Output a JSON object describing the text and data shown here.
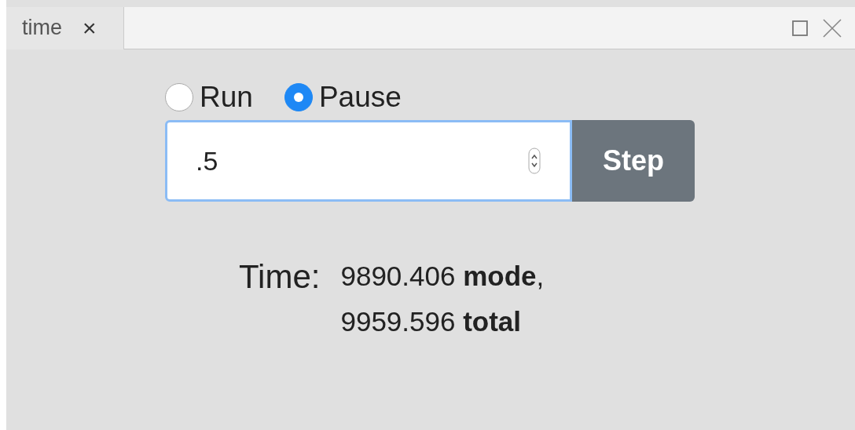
{
  "tab": {
    "label": "time",
    "close": "×",
    "selected": true
  },
  "modes": [
    {
      "label": "Run",
      "selected": false
    },
    {
      "label": "Pause",
      "selected": true
    }
  ],
  "step_field": {
    "value": ".5"
  },
  "step_button": "Step",
  "time": {
    "label": "Time:",
    "lines": [
      "9890.406 **mode**,",
      "9959.596 **total**"
    ]
  }
}
